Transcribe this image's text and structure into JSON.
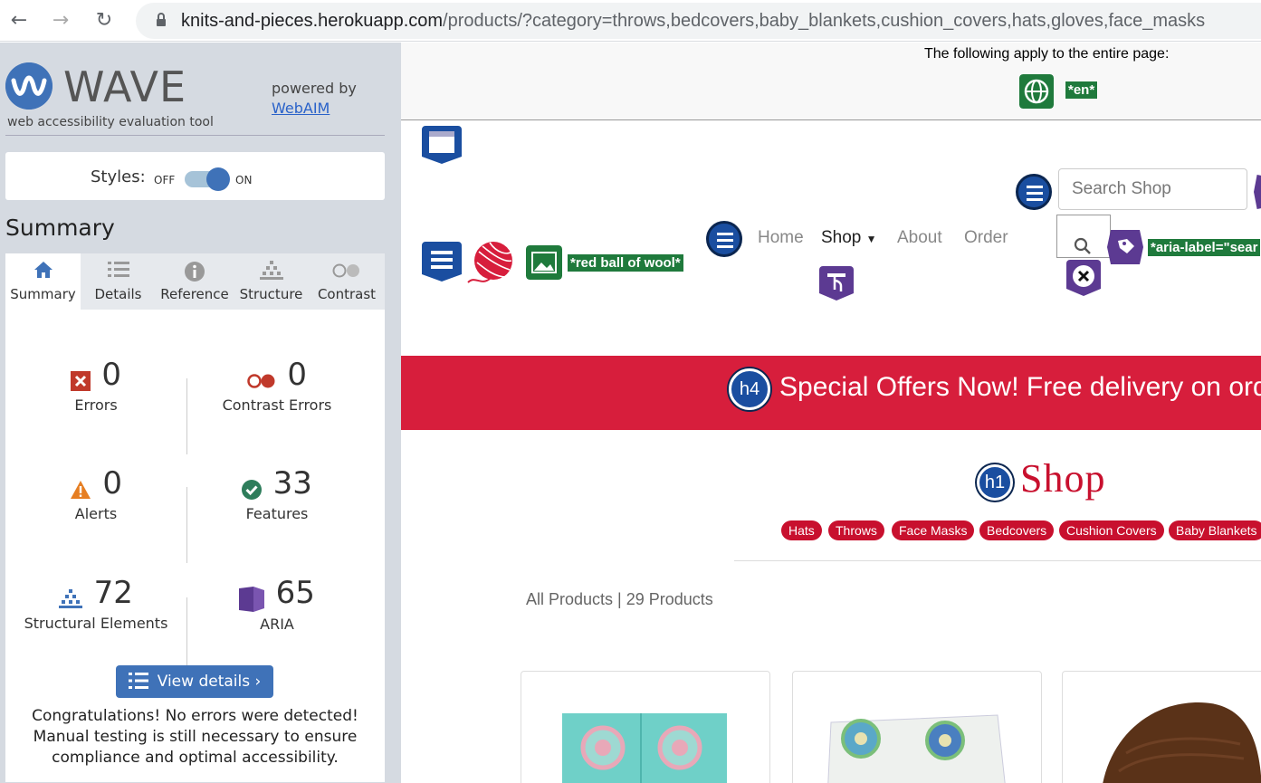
{
  "browser": {
    "url_host": "knits-and-pieces.herokuapp.com",
    "url_rest": "/products/?category=throws,bedcovers,baby_blankets,cushion_covers,hats,gloves,face_masks"
  },
  "wave": {
    "title": "WAVE",
    "subtitle": "web accessibility evaluation tool",
    "powered_by": "powered by",
    "webaim_link": "WebAIM",
    "styles_label": "Styles:",
    "styles_off": "OFF",
    "styles_on": "ON",
    "summary_heading": "Summary",
    "tabs": [
      {
        "label": "Summary",
        "icon": "home-icon"
      },
      {
        "label": "Details",
        "icon": "details-list-icon"
      },
      {
        "label": "Reference",
        "icon": "info-icon"
      },
      {
        "label": "Structure",
        "icon": "structure-icon"
      },
      {
        "label": "Contrast",
        "icon": "contrast-icon"
      }
    ],
    "stats": {
      "errors": {
        "value": "0",
        "label": "Errors"
      },
      "contrast_errors": {
        "value": "0",
        "label": "Contrast Errors"
      },
      "alerts": {
        "value": "0",
        "label": "Alerts"
      },
      "features": {
        "value": "33",
        "label": "Features"
      },
      "structural": {
        "value": "72",
        "label": "Structural Elements"
      },
      "aria": {
        "value": "65",
        "label": "ARIA"
      }
    },
    "view_details": "View details ›",
    "congrats": "Congratulations! No errors were detected! Manual testing is still necessary to ensure compliance and optimal accessibility.",
    "colors": {
      "accent": "#3f72b8",
      "sidebar_bg": "#d5dae1",
      "error": "#c0392b",
      "alert": "#e67e22",
      "feature": "#2e7d5b",
      "aria": "#5c3a92"
    }
  },
  "site": {
    "page_notice": "The following apply to the entire page:",
    "lang_tag": "*en*",
    "logo_alt_tag": "*red ball of wool*",
    "nav": {
      "home": "Home",
      "shop": "Shop",
      "about": "About",
      "order": "Order"
    },
    "search_placeholder": "Search Shop",
    "aria_label_tag": "*aria-label=\"sear",
    "banner_text": "Special Offers Now! Free delivery on orders",
    "h4": "h4",
    "h1": "h1",
    "shop_title": "Shop",
    "categories": [
      "Hats",
      "Throws",
      "Face Masks",
      "Bedcovers",
      "Cushion Covers",
      "Baby Blankets"
    ],
    "product_count": "All Products | 29 Products",
    "colors": {
      "brand_red": "#c8102e",
      "banner_red": "#d71e3c"
    }
  }
}
